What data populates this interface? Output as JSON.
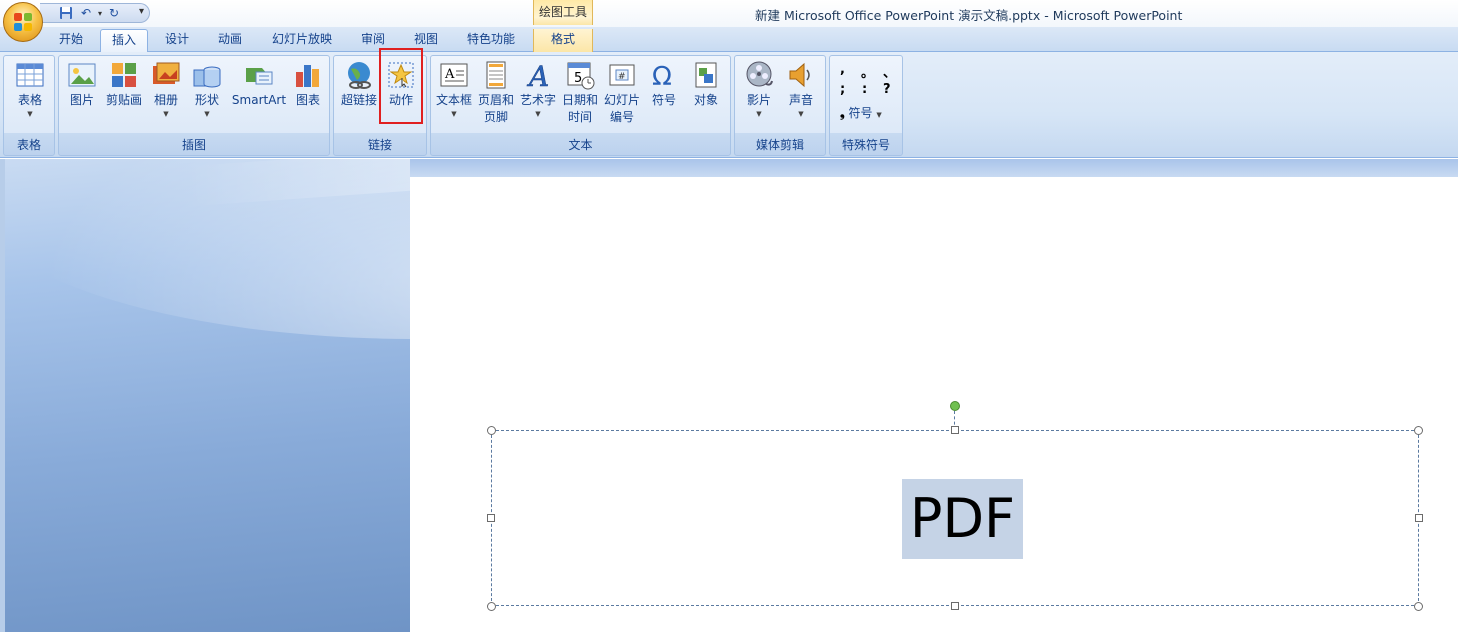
{
  "window": {
    "title": "新建 Microsoft Office PowerPoint 演示文稿.pptx - Microsoft PowerPoint",
    "contextual_tab_group": "绘图工具"
  },
  "tabs": [
    {
      "label": "开始",
      "active": false
    },
    {
      "label": "插入",
      "active": true
    },
    {
      "label": "设计",
      "active": false
    },
    {
      "label": "动画",
      "active": false
    },
    {
      "label": "幻灯片放映",
      "active": false
    },
    {
      "label": "审阅",
      "active": false
    },
    {
      "label": "视图",
      "active": false
    },
    {
      "label": "特色功能",
      "active": false
    },
    {
      "label": "格式",
      "active": false
    }
  ],
  "ribbon": {
    "groups": {
      "table": {
        "label": "表格",
        "buttons": {
          "table": "表格"
        }
      },
      "illustrations": {
        "label": "插图",
        "buttons": {
          "picture": "图片",
          "clipart": "剪贴画",
          "album": "相册",
          "shapes": "形状",
          "smartart": "SmartArt",
          "chart": "图表"
        }
      },
      "links": {
        "label": "链接",
        "buttons": {
          "hyperlink": "超链接",
          "action": "动作"
        }
      },
      "text": {
        "label": "文本",
        "buttons": {
          "textbox": "文本框",
          "header_footer_1": "页眉和",
          "header_footer_2": "页脚",
          "wordart": "艺术字",
          "datetime_1": "日期和",
          "datetime_2": "时间",
          "slidenum_1": "幻灯片",
          "slidenum_2": "编号",
          "symbol": "符号",
          "object": "对象"
        }
      },
      "media": {
        "label": "媒体剪辑",
        "buttons": {
          "movie": "影片",
          "sound": "声音"
        }
      },
      "special": {
        "label": "特殊符号",
        "buttons": {
          "symbol": "符号"
        },
        "symbols": [
          ",",
          "。",
          "、",
          ";",
          ":",
          "?"
        ]
      }
    }
  },
  "slide": {
    "text": "PDF"
  }
}
